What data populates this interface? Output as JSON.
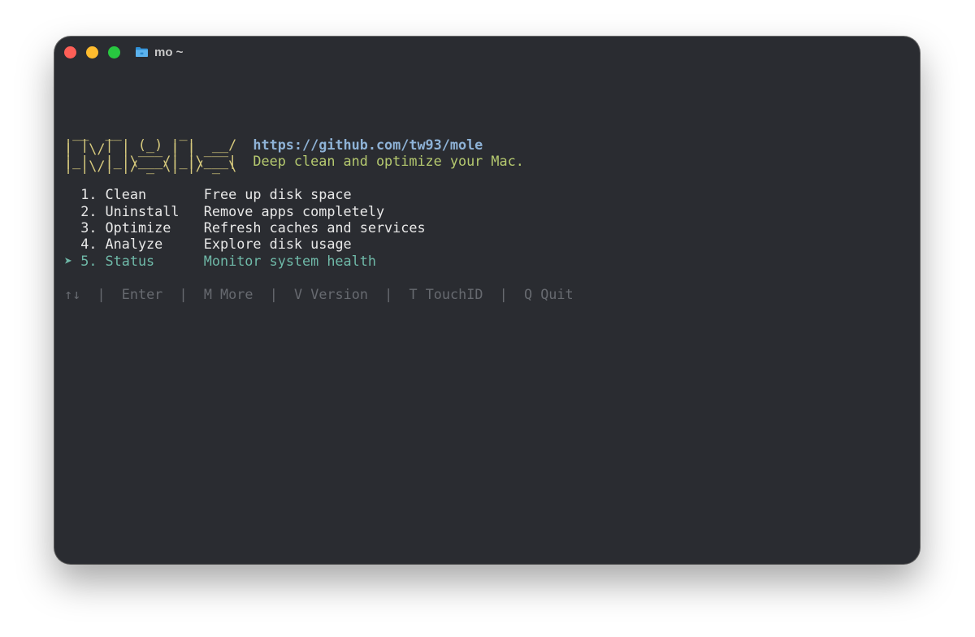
{
  "window": {
    "title": "mo ~",
    "traffic_lights": [
      "close",
      "minimize",
      "maximize"
    ],
    "folder_icon": "folder-icon"
  },
  "logo": {
    "lines": [
      " __  __       _      ",
      "|  \\/  | ___ | | ___ ",
      "| |\\/| |/ _ \\| |/ _ \\",
      "| |  | | (_) | |  __/",
      "|_|  |_|\\___/|_|\\___|"
    ]
  },
  "header": {
    "url": "https://github.com/tw93/mole",
    "tagline": "Deep clean and optimize your Mac."
  },
  "menu": {
    "selected_marker": "➤",
    "items": [
      {
        "label": "1. Clean",
        "description": "Free up disk space"
      },
      {
        "label": "2. Uninstall",
        "description": "Remove apps completely"
      },
      {
        "label": "3. Optimize",
        "description": "Refresh caches and services"
      },
      {
        "label": "4. Analyze",
        "description": "Explore disk usage"
      },
      {
        "label": "5. Status",
        "description": "Monitor system health"
      }
    ],
    "selected_index": 4
  },
  "help_bar": {
    "items": [
      "↑↓",
      "Enter",
      "M More",
      "V Version",
      "T TouchID",
      "Q Quit"
    ],
    "separator": "|"
  },
  "colors": {
    "background": "#2a2c31",
    "logo": "#d8cb7e",
    "url": "#8eb2d6",
    "tagline": "#b5c96f",
    "selected": "#6fb9a8",
    "help": "#676a70",
    "text": "#e8e8e8"
  }
}
